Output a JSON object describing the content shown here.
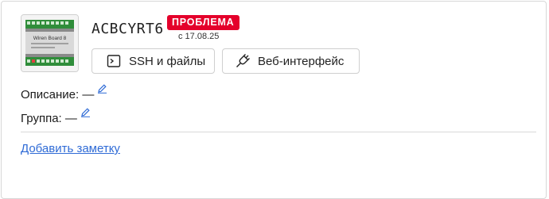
{
  "device": {
    "name": "ACBCYRT6",
    "status_badge": "ПРОБЛЕМА",
    "status_date": "с 17.08.25",
    "thumbnail_label": "Wiren Board 8",
    "status_color": "#e4002b"
  },
  "actions": {
    "ssh_label": "SSH и файлы",
    "web_label": "Веб-интерфейс"
  },
  "fields": {
    "description_label": "Описание: —",
    "group_label": "Группа: —"
  },
  "links": {
    "add_note": "Добавить заметку",
    "link_color": "#2f6bd6"
  },
  "icons": {
    "ssh": "terminal-icon",
    "web": "plug-icon",
    "edit": "pencil-edit-icon"
  }
}
